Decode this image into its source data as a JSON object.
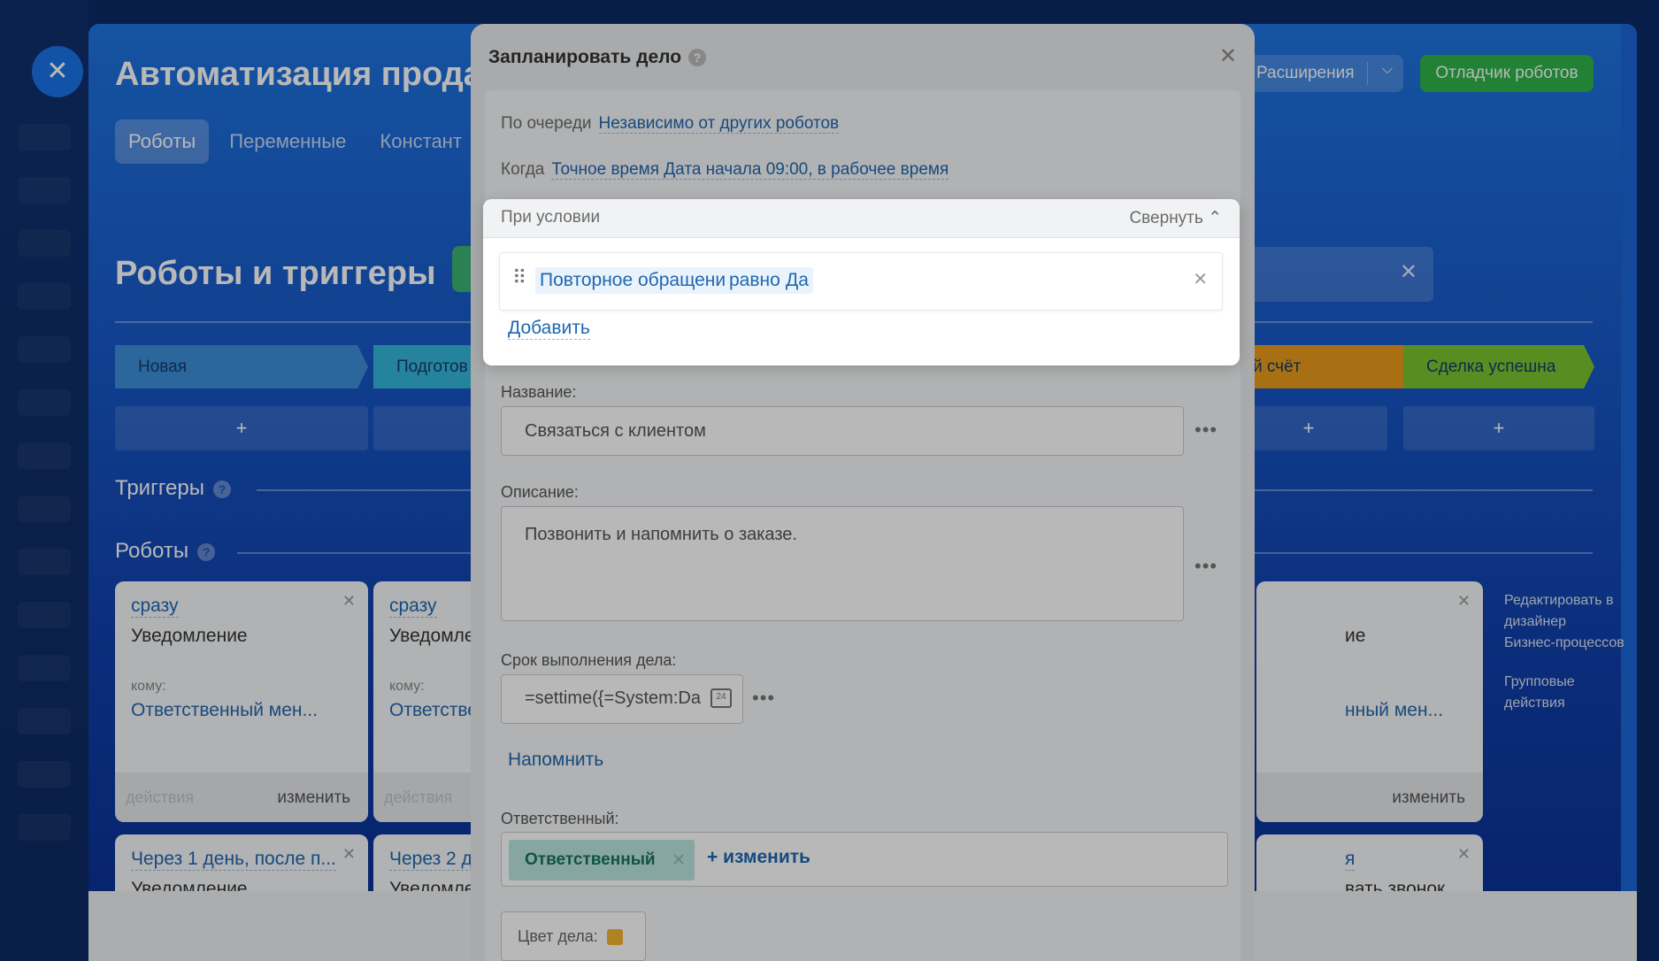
{
  "background": {
    "title": "Автоматизация прода",
    "tabs": [
      "Роботы",
      "Переменные",
      "Констант"
    ],
    "extensions_label": "Расширения",
    "debugger_label": "Отладчик роботов",
    "section_title": "Роботы и триггеры",
    "stages": [
      {
        "label": "Новая",
        "color": "#3c8fd8"
      },
      {
        "label": "Подготов",
        "color": "#35b6db"
      },
      {
        "label": "й счёт",
        "color": "#e99b1b"
      },
      {
        "label": "Сделка успешна",
        "color": "#7bc52e"
      }
    ],
    "plus": "+",
    "triggers_label": "Триггеры",
    "robots_label": "Роботы",
    "help": "?",
    "cards": [
      {
        "when": "сразу",
        "kind": "Уведомление",
        "to_label": "кому:",
        "to_value": "Ответственный мен...",
        "actions": "действия",
        "edit": "изменить"
      },
      {
        "when": "сразу",
        "kind": "Уведомле",
        "to_label": "кому:",
        "to_value": "Ответстве",
        "actions": "действия",
        "edit": ""
      },
      {
        "when": "",
        "kind": "ие",
        "to_label": "",
        "to_value": "нный мен...",
        "actions": "",
        "edit": "изменить"
      },
      {
        "when": "Через 1 день, после п...",
        "kind": "Уведомление"
      },
      {
        "when": "Через 2 д",
        "kind": "Уведомле"
      },
      {
        "when": "я",
        "kind": "вать звонок"
      }
    ],
    "side_links": [
      "Редактировать в дизайнер",
      "Бизнес-процессов",
      "Групповые действия"
    ]
  },
  "modal": {
    "title": "Запланировать дело",
    "help": "?",
    "queue_label": "По очереди",
    "queue_value": "Независимо от других роботов",
    "when_label": "Когда",
    "when_value": "Точное время Дата начала 09:00, в рабочее время",
    "name_label": "Название:",
    "name_value": "Связаться с клиентом",
    "desc_label": "Описание:",
    "desc_value": "Позвонить и напомнить о заказе.",
    "deadline_label": "Срок выполнения дела:",
    "deadline_value": "=settime({=System:Da",
    "calendar_day": "24",
    "dots": "•••",
    "remind": "Напомнить",
    "responsible_label": "Ответственный:",
    "responsible_chip": "Ответственный",
    "change": "+ изменить",
    "color_label": "Цвет дела:",
    "color_value": "#f5b533"
  },
  "condition": {
    "title": "При условии",
    "collapse": "Свернуть",
    "field": "Повторное обращение",
    "operator": "равно",
    "value": "Да",
    "add": "Добавить"
  }
}
